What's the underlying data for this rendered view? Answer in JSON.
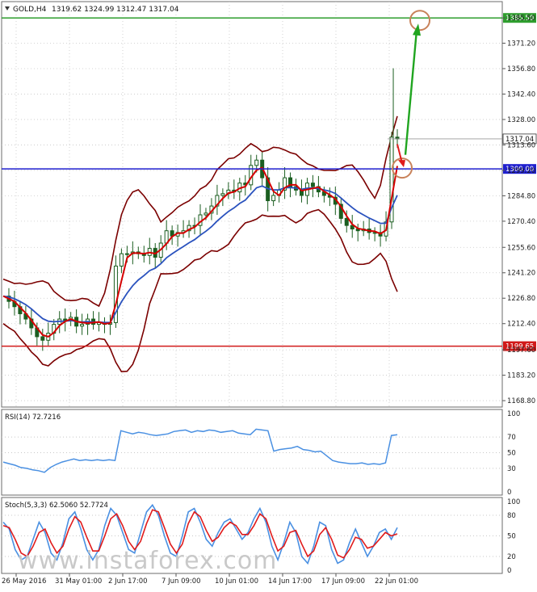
{
  "header": {
    "symbol_timeframe": "GOLD,H4",
    "ohlc": "1319.62 1324.99 1312.47 1317.04"
  },
  "watermark": "www.instaforex.com",
  "colors": {
    "border": "#6b6b6b",
    "grid": "#c8c8c8",
    "candle": "#1b5e20",
    "sma": "#d40000",
    "ema": "#2a52be",
    "bollinger": "#7b0000",
    "level_green": "#2e9e2e",
    "level_blue": "#1f1fcf",
    "level_red": "#d11a1a",
    "arrow_green": "#20a520",
    "arrow_red": "#e01b1b",
    "circle": "#c8825a",
    "rsi_line": "#4a90e2",
    "stoch_main": "#4a90e2",
    "stoch_signal": "#e01b1b",
    "watermark": "#c9c9c9"
  },
  "chart_data": [
    {
      "type": "candlestick",
      "panel": "main",
      "ylim": [
        1167,
        1392
      ],
      "yticks": [
        "1385.50",
        "1371.20",
        "1356.80",
        "1342.40",
        "1328.00",
        "1313.60",
        "1299.20",
        "1284.80",
        "1270.40",
        "1255.60",
        "1241.20",
        "1226.80",
        "1212.40",
        "1197.60",
        "1183.20",
        "1168.80"
      ],
      "levels": [
        {
          "value": 1385.5,
          "label": "1385.50",
          "color": "level_green"
        },
        {
          "value": 1300.0,
          "label": "1300.00",
          "color": "level_blue"
        },
        {
          "value": 1199.65,
          "label": "1199.65",
          "color": "level_red"
        }
      ],
      "current_price": {
        "value": 1317.04,
        "label": "1317.04"
      },
      "x_categories": [
        "26 May 2016",
        "31 May 01:00",
        "2 Jun 17:00",
        "7 Jun 09:00",
        "10 Jun 01:00",
        "14 Jun 17:00",
        "17 Jun 09:00",
        "22 Jun 01:00"
      ],
      "close_path": [
        1228,
        1225,
        1222,
        1218,
        1215,
        1210,
        1205,
        1203,
        1207,
        1212,
        1215,
        1214,
        1216,
        1211,
        1212,
        1215,
        1212,
        1213,
        1212,
        1213,
        1245,
        1252,
        1252,
        1253,
        1252,
        1251,
        1255,
        1250,
        1258,
        1265,
        1262,
        1264,
        1265,
        1268,
        1268,
        1274,
        1275,
        1279,
        1285,
        1286,
        1288,
        1287,
        1292,
        1291,
        1302,
        1305,
        1295,
        1282,
        1285,
        1288,
        1295,
        1290,
        1288,
        1285,
        1292,
        1290,
        1287,
        1285,
        1284,
        1280,
        1272,
        1268,
        1266,
        1265,
        1266,
        1264,
        1264,
        1262,
        1270,
        1318,
        1317
      ]
    },
    {
      "type": "line",
      "panel": "rsi",
      "title": "RSI(14) 72.7216",
      "ylim": [
        0,
        100
      ],
      "yticks": [
        "100",
        "70",
        "50",
        "30",
        "0"
      ],
      "values": [
        38,
        36,
        34,
        31,
        30,
        28,
        27,
        25,
        31,
        35,
        38,
        40,
        42,
        40,
        41,
        40,
        41,
        40,
        41,
        40,
        78,
        76,
        74,
        76,
        75,
        73,
        72,
        73,
        74,
        77,
        78,
        79,
        76,
        78,
        77,
        79,
        78,
        76,
        77,
        78,
        75,
        74,
        73,
        80,
        79,
        78,
        52,
        54,
        55,
        56,
        58,
        54,
        53,
        51,
        52,
        46,
        40,
        38,
        37,
        36,
        36,
        37,
        35,
        36,
        35,
        37,
        72,
        73
      ]
    },
    {
      "type": "line",
      "panel": "stochastic",
      "title": "Stoch(5,3,3) 62.5060 52.7724",
      "ylim": [
        0,
        100
      ],
      "yticks": [
        "100",
        "80",
        "50",
        "20",
        "0"
      ],
      "series": [
        {
          "name": "main",
          "values": [
            70,
            60,
            30,
            15,
            20,
            45,
            70,
            55,
            25,
            15,
            40,
            75,
            85,
            60,
            30,
            15,
            30,
            65,
            90,
            80,
            55,
            30,
            25,
            55,
            85,
            95,
            80,
            50,
            25,
            20,
            50,
            85,
            90,
            70,
            45,
            35,
            55,
            70,
            75,
            60,
            45,
            55,
            75,
            90,
            70,
            35,
            15,
            40,
            70,
            55,
            20,
            10,
            35,
            70,
            65,
            30,
            10,
            15,
            40,
            60,
            40,
            20,
            35,
            55,
            60,
            45,
            62
          ]
        },
        {
          "name": "signal",
          "values": [
            65,
            62,
            45,
            25,
            20,
            35,
            55,
            60,
            40,
            25,
            35,
            60,
            78,
            70,
            48,
            28,
            28,
            50,
            75,
            82,
            65,
            42,
            30,
            42,
            68,
            88,
            85,
            62,
            38,
            25,
            38,
            68,
            85,
            78,
            58,
            42,
            48,
            62,
            70,
            65,
            52,
            52,
            65,
            82,
            75,
            50,
            28,
            35,
            55,
            58,
            38,
            20,
            28,
            52,
            62,
            45,
            22,
            18,
            30,
            48,
            45,
            32,
            35,
            45,
            55,
            50,
            53
          ]
        }
      ]
    }
  ]
}
